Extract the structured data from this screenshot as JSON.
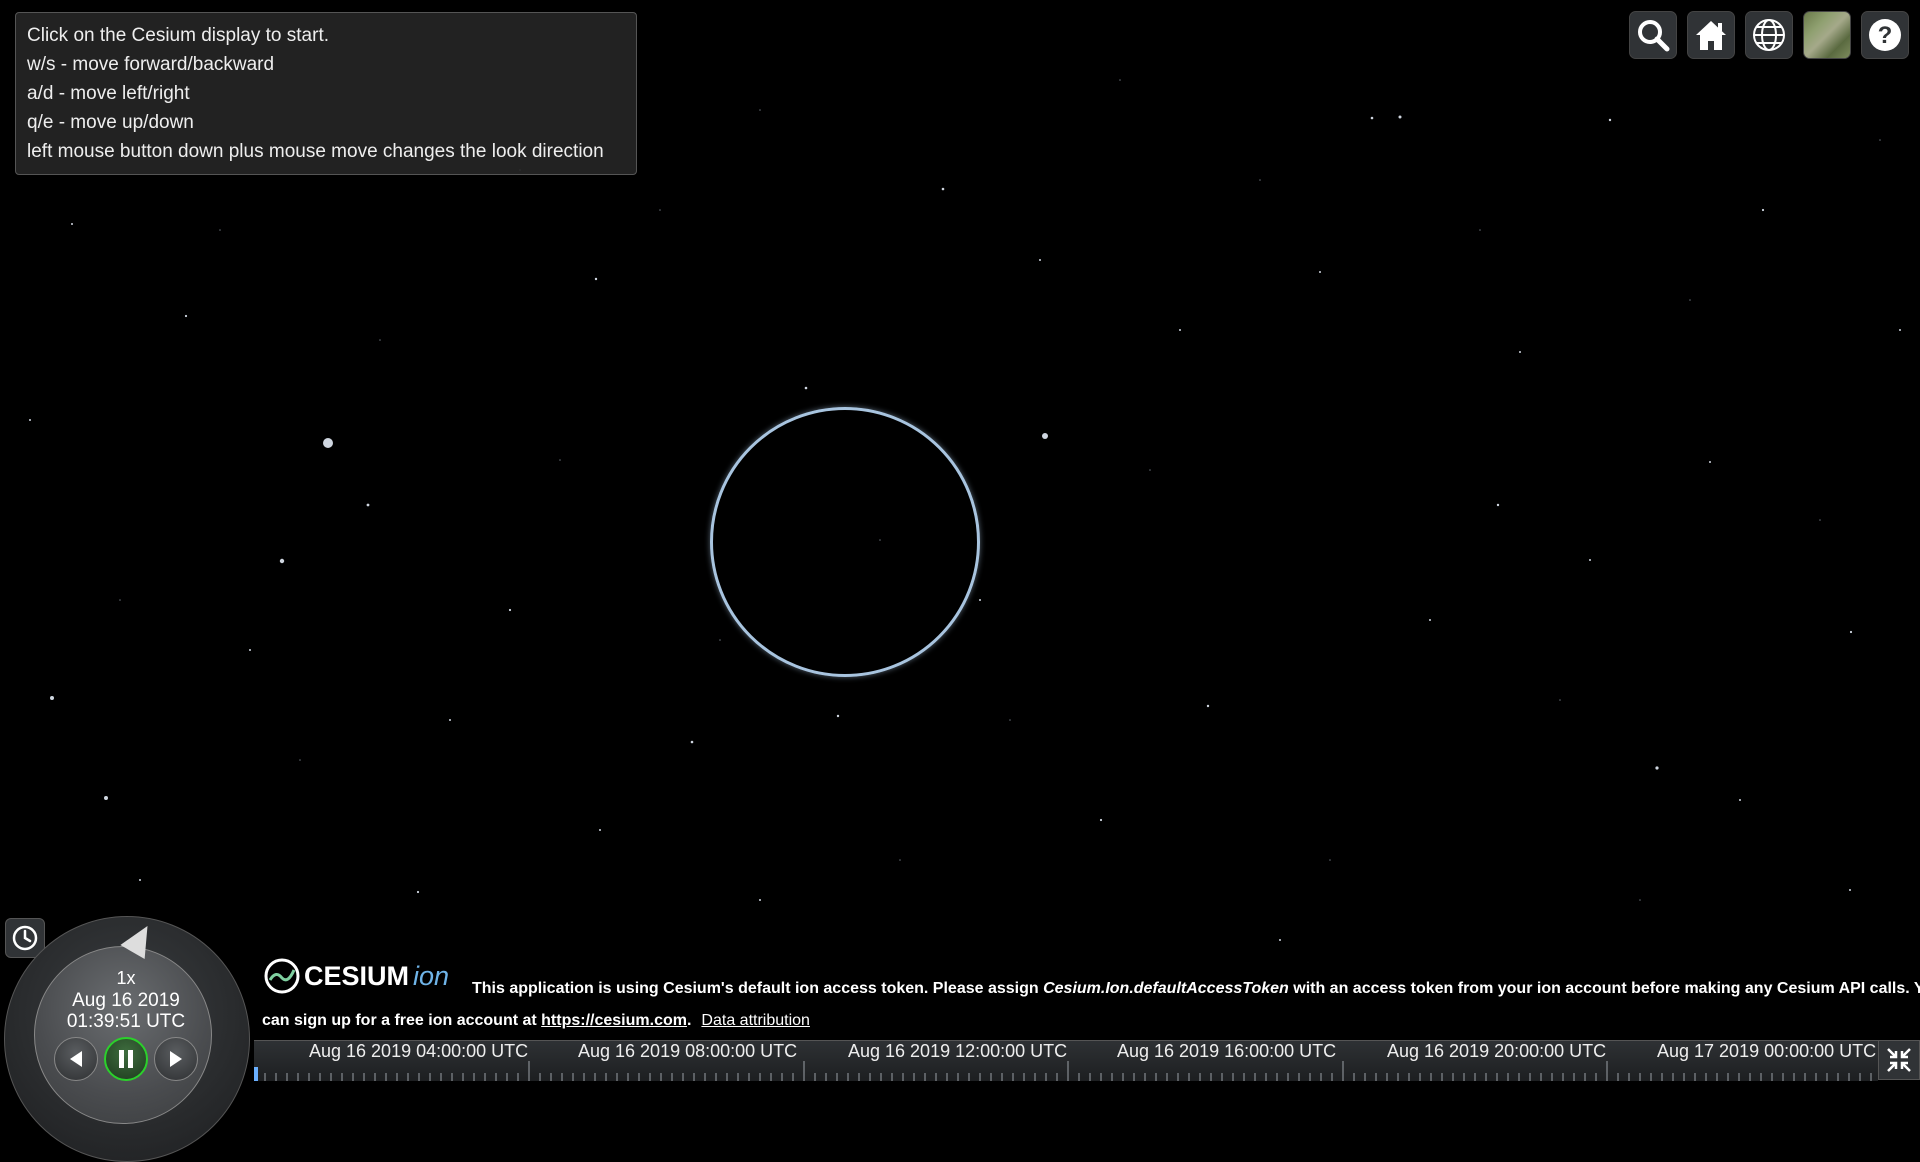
{
  "instructions": {
    "lines": [
      "Click on the Cesium display to start.",
      "w/s - move forward/backward",
      "a/d - move left/right",
      "q/e - move up/down",
      "left mouse button down plus mouse move changes the look direction"
    ]
  },
  "toolbar": {
    "buttons": [
      {
        "name": "search-icon"
      },
      {
        "name": "home-icon"
      },
      {
        "name": "globe-icon"
      },
      {
        "name": "base-layer-picker"
      },
      {
        "name": "help-icon"
      }
    ]
  },
  "animation": {
    "speed": "1x",
    "date": "Aug 16 2019",
    "time": "01:39:51 UTC"
  },
  "credits": {
    "logo_text": "CESIUM",
    "logo_ion": "ion",
    "line1_prefix": "This application is using Cesium's default ion access token. Please assign ",
    "line1_token": "Cesium.Ion.defaultAccessToken",
    "line1_suffix": " with an access token from your ion account before making any Cesium API calls. You",
    "line2_prefix": "can sign up for a free ion account at ",
    "line2_link": "https://cesium.com",
    "line2_suffix": ".",
    "data_attribution": "Data attribution"
  },
  "timeline": {
    "labels": [
      "Aug 16 2019 04:00:00 UTC",
      "Aug 16 2019 08:00:00 UTC",
      "Aug 16 2019 12:00:00 UTC",
      "Aug 16 2019 16:00:00 UTC",
      "Aug 16 2019 20:00:00 UTC",
      "Aug 17 2019 00:00:00 UTC"
    ]
  },
  "colors": {
    "background": "#000000",
    "globe_ring": "#a8c4df",
    "active_play": "#2bd12b",
    "ion_accent": "#6fb4e8"
  }
}
